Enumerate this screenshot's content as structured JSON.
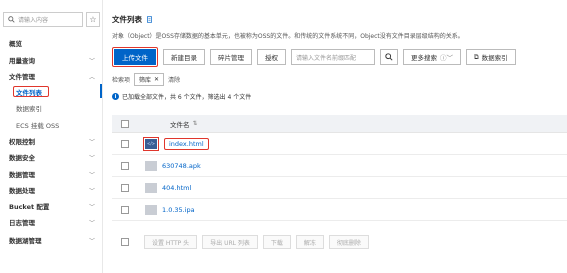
{
  "sidebar": {
    "search_placeholder": "请输入内容",
    "items": [
      {
        "label": "概览"
      },
      {
        "label": "用量查询"
      },
      {
        "label": "文件管理"
      },
      {
        "label": "文件列表"
      },
      {
        "label": "数据索引"
      },
      {
        "label": "ECS 挂载 OSS"
      },
      {
        "label": "权限控制"
      },
      {
        "label": "数据安全"
      },
      {
        "label": "数据管理"
      },
      {
        "label": "数据处理"
      },
      {
        "label": "Bucket 配置"
      },
      {
        "label": "日志管理"
      },
      {
        "label": "数据湖管理"
      }
    ]
  },
  "header": {
    "title": "文件列表",
    "description": "对象（Object）是OSS存储数据的基本单元，也被称为OSS的文件。和传统的文件系统不同，Object没有文件目录层级结构的关系。"
  },
  "toolbar": {
    "upload": "上传文件",
    "new_dir": "新建目录",
    "fragments": "碎片管理",
    "authorize": "授权",
    "search_placeholder": "请输入文件名前缀匹配",
    "more_search": "更多搜索",
    "data_index": "数据索引"
  },
  "filter": {
    "label": "检索项",
    "tag": "筛库",
    "clear": "清除"
  },
  "info": {
    "text": "已加载全部文件，共 6 个文件，筛选出 4 个文件"
  },
  "table": {
    "column_name": "文件名",
    "rows": [
      {
        "name": "index.html"
      },
      {
        "name": "630748.apk"
      },
      {
        "name": "404.html"
      },
      {
        "name": "1.0.35.ipa"
      }
    ]
  },
  "bottom": {
    "set_http": "设置 HTTP 头",
    "export_url": "导出 URL 列表",
    "download": "下载",
    "unfreeze": "解冻",
    "delete": "彻底删除"
  },
  "colors": {
    "accent": "#0064c8",
    "highlight": "#e0362c"
  }
}
